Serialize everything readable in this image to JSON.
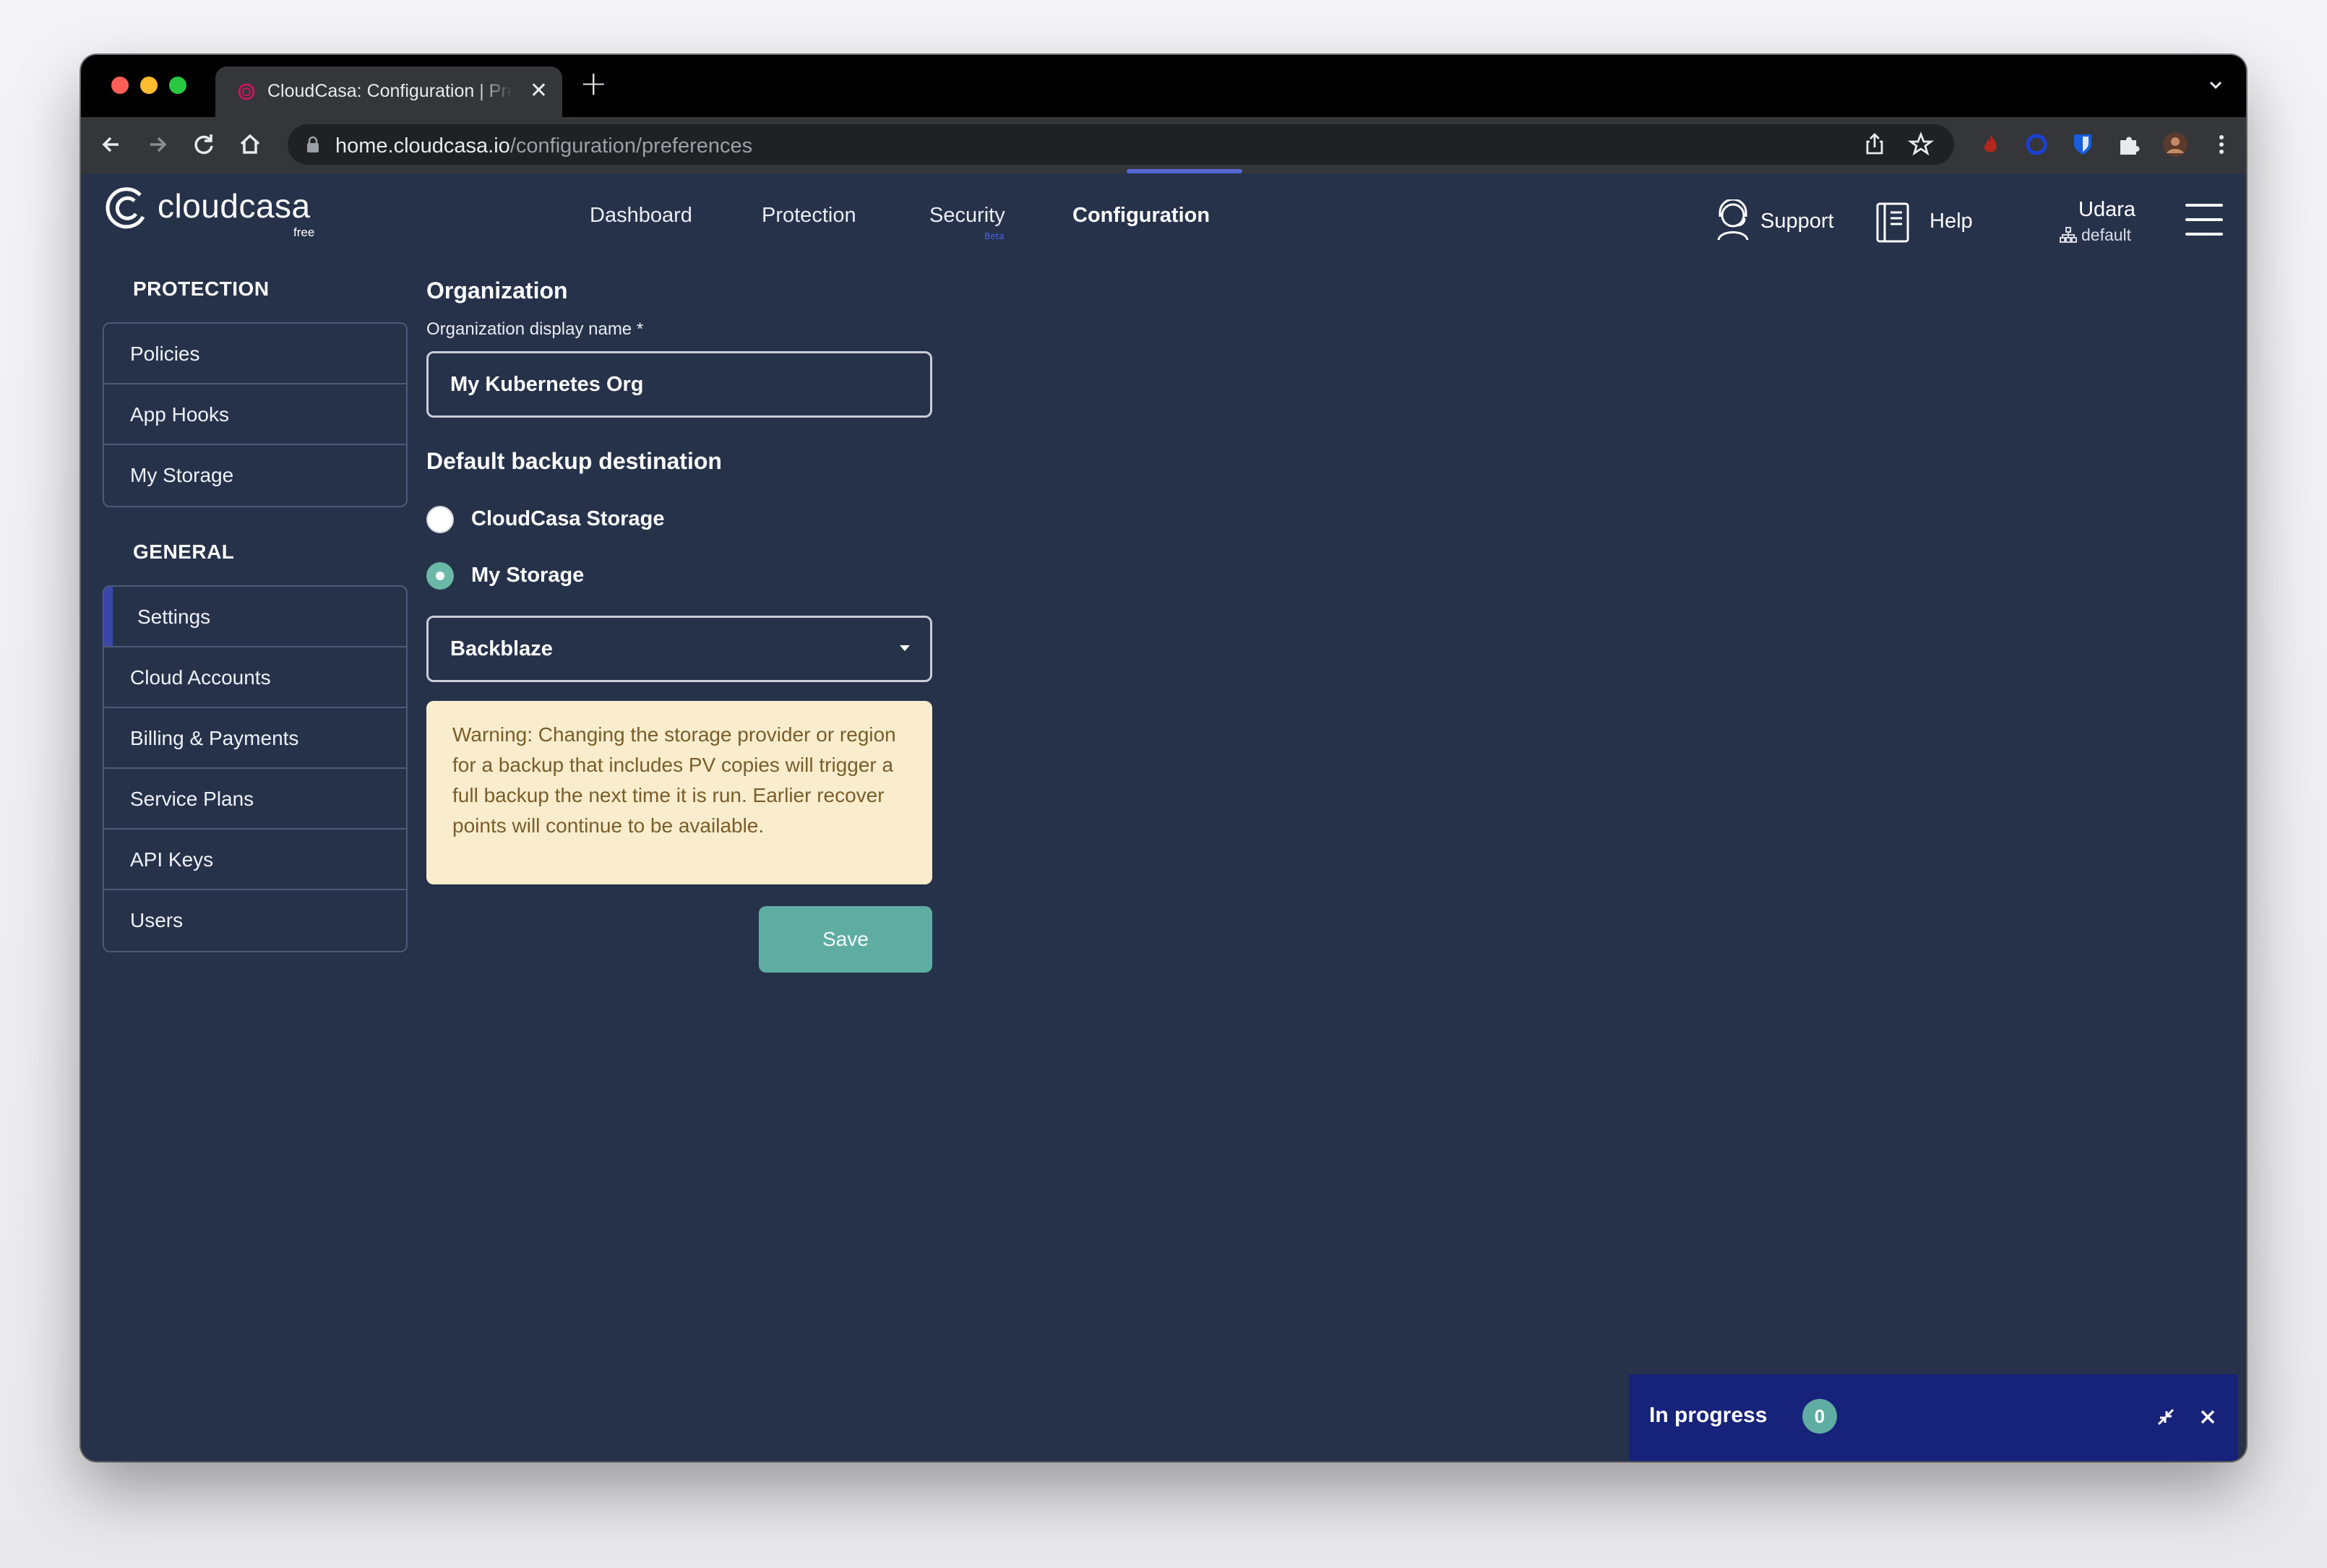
{
  "browser": {
    "tab_title": "CloudCasa: Configuration | Preferences",
    "tab_close": "✕",
    "new_tab": "+",
    "url_host": "home.cloudcasa.io",
    "url_path": "/configuration/preferences"
  },
  "app": {
    "logo_text": "cloudcasa",
    "logo_sub": "free",
    "nav": [
      {
        "label": "Dashboard"
      },
      {
        "label": "Protection"
      },
      {
        "label": "Security",
        "badge": "Beta"
      },
      {
        "label": "Configuration",
        "active": true
      }
    ],
    "support_label": "Support",
    "help_label": "Help",
    "user_name": "Udara",
    "user_org": "default"
  },
  "sidebar": {
    "protection_heading": "PROTECTION",
    "protection_items": [
      {
        "label": "Policies"
      },
      {
        "label": "App Hooks"
      },
      {
        "label": "My Storage"
      }
    ],
    "general_heading": "GENERAL",
    "general_items": [
      {
        "label": "Settings",
        "active": true
      },
      {
        "label": "Cloud Accounts"
      },
      {
        "label": "Billing & Payments"
      },
      {
        "label": "Service Plans"
      },
      {
        "label": "API Keys"
      },
      {
        "label": "Users"
      }
    ]
  },
  "form": {
    "org_heading": "Organization",
    "org_name_label": "Organization display name *",
    "org_name_value": "My Kubernetes Org",
    "backup_heading": "Default backup destination",
    "option_cloudcasa": "CloudCasa Storage",
    "option_my_storage": "My Storage",
    "selected_option": "My Storage",
    "storage_select_value": "Backblaze",
    "warning_text": "Warning: Changing the storage provider or region for a backup that includes PV copies will trigger a full backup the next time it is run. Earlier recover points will continue to be available.",
    "save_label": "Save"
  },
  "progress_panel": {
    "title": "In progress",
    "count": "0"
  },
  "colors": {
    "page_bg": "#26324a",
    "accent_teal": "#5fada2",
    "progress_bg": "#17227b",
    "warning_bg": "#f9edcd",
    "active_marker": "#3a47a8"
  }
}
